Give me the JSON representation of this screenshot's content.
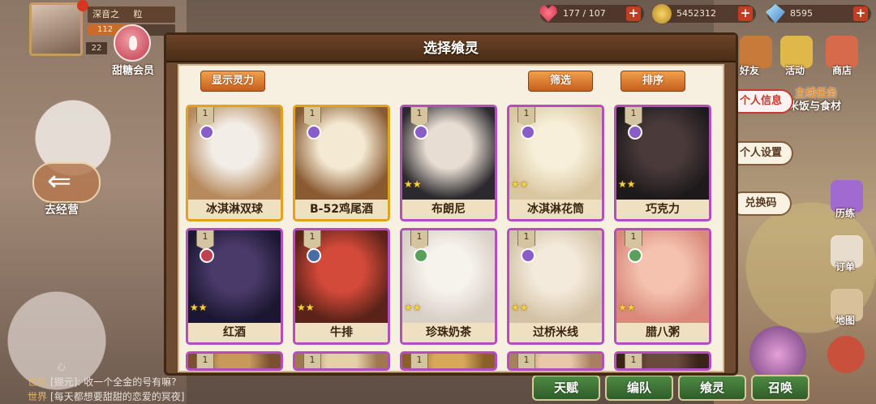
{
  "top_bar": {
    "player_name": "深音之",
    "player_name_tail": "粒",
    "exp_text": "112",
    "level": "22",
    "exp_fraction": 0.55,
    "vip_label": "甜糖会员",
    "heart": {
      "value": "177 / 107",
      "icon": "heart-icon"
    },
    "coin": {
      "value": "5452312",
      "icon": "coin-icon"
    },
    "gem": {
      "value": "8595",
      "icon": "gem-icon"
    },
    "plus_label": "+"
  },
  "side_menu": {
    "friends": "好友",
    "mail": "活动",
    "shop": "商店",
    "task": "主线任务",
    "task_sub": "米饭与食材",
    "personal_info": "个人信息",
    "personal_settings": "个人设置",
    "redeem": "兑换码",
    "training": "历练",
    "orders": "订单",
    "map": "地图"
  },
  "left": {
    "back_label": "去经营"
  },
  "chat": {
    "tag": "心",
    "rows": [
      {
        "channel": "世界",
        "text": "[撷元]: 收一个全金的号有嘛?"
      },
      {
        "channel": "世界",
        "text": "[每天都想要甜甜的恋爱的冥夜]"
      }
    ]
  },
  "bottom_bar": [
    "天赋",
    "编队",
    "飨灵",
    "召唤"
  ],
  "dialog": {
    "title": "选择飨灵",
    "show_power": "显示灵力",
    "filter": "筛选",
    "sort": "排序",
    "cards": [
      {
        "name": "冰淇淋双球",
        "level": "1",
        "rarity": "gold",
        "stars": "",
        "type_color": "#8a5cc8",
        "portrait": [
          "#f2ede6",
          "#b78a5e"
        ]
      },
      {
        "name": "B-52鸡尾酒",
        "level": "1",
        "rarity": "gold",
        "stars": "",
        "type_color": "#8a5cc8",
        "portrait": [
          "#f4e9d2",
          "#8a5a33"
        ]
      },
      {
        "name": "布朗尼",
        "level": "1",
        "rarity": "purple",
        "stars": "★★",
        "type_color": "#8a5cc8",
        "portrait": [
          "#e8ddd2",
          "#2c2a2e"
        ]
      },
      {
        "name": "冰淇淋花筒",
        "level": "1",
        "rarity": "purple",
        "stars": "★★",
        "type_color": "#8a5cc8",
        "portrait": [
          "#f7efd9",
          "#d9c6a0"
        ]
      },
      {
        "name": "巧克力",
        "level": "1",
        "rarity": "purple",
        "stars": "★★",
        "type_color": "#8a5cc8",
        "portrait": [
          "#4a3a3a",
          "#1e1a1c"
        ]
      },
      {
        "name": "红酒",
        "level": "1",
        "rarity": "purple",
        "stars": "★★",
        "type_color": "#c04050",
        "portrait": [
          "#4a3a6a",
          "#1c1730"
        ]
      },
      {
        "name": "牛排",
        "level": "1",
        "rarity": "purple",
        "stars": "★★",
        "type_color": "#4a6aa8",
        "portrait": [
          "#d44a3a",
          "#5a2218"
        ]
      },
      {
        "name": "珍珠奶茶",
        "level": "1",
        "rarity": "purple",
        "stars": "★★",
        "type_color": "#5aa05a",
        "portrait": [
          "#f6f2ec",
          "#d8cfc6"
        ]
      },
      {
        "name": "过桥米线",
        "level": "1",
        "rarity": "purple",
        "stars": "★★",
        "type_color": "#8a5cc8",
        "portrait": [
          "#f4eadb",
          "#d3c2a6"
        ]
      },
      {
        "name": "腊八粥",
        "level": "1",
        "rarity": "purple",
        "stars": "★★",
        "type_color": "#5aa05a",
        "portrait": [
          "#f5c2b0",
          "#d98a7a"
        ]
      },
      {
        "name": "",
        "level": "1",
        "rarity": "purple",
        "stars": "",
        "type_color": "#8a5cc8",
        "portrait": [
          "#c89a5a",
          "#7a5030"
        ]
      },
      {
        "name": "",
        "level": "1",
        "rarity": "purple",
        "stars": "",
        "type_color": "#8a5cc8",
        "portrait": [
          "#e6d0a8",
          "#a07850"
        ]
      },
      {
        "name": "",
        "level": "1",
        "rarity": "purple",
        "stars": "",
        "type_color": "#8a5cc8",
        "portrait": [
          "#d6a858",
          "#8a6028"
        ]
      },
      {
        "name": "",
        "level": "1",
        "rarity": "purple",
        "stars": "",
        "type_color": "#8a5cc8",
        "portrait": [
          "#e8c8a8",
          "#a88060"
        ]
      },
      {
        "name": "",
        "level": "1",
        "rarity": "purple",
        "stars": "",
        "type_color": "#8a5cc8",
        "portrait": [
          "#6a4a3a",
          "#3a2418"
        ]
      }
    ]
  }
}
